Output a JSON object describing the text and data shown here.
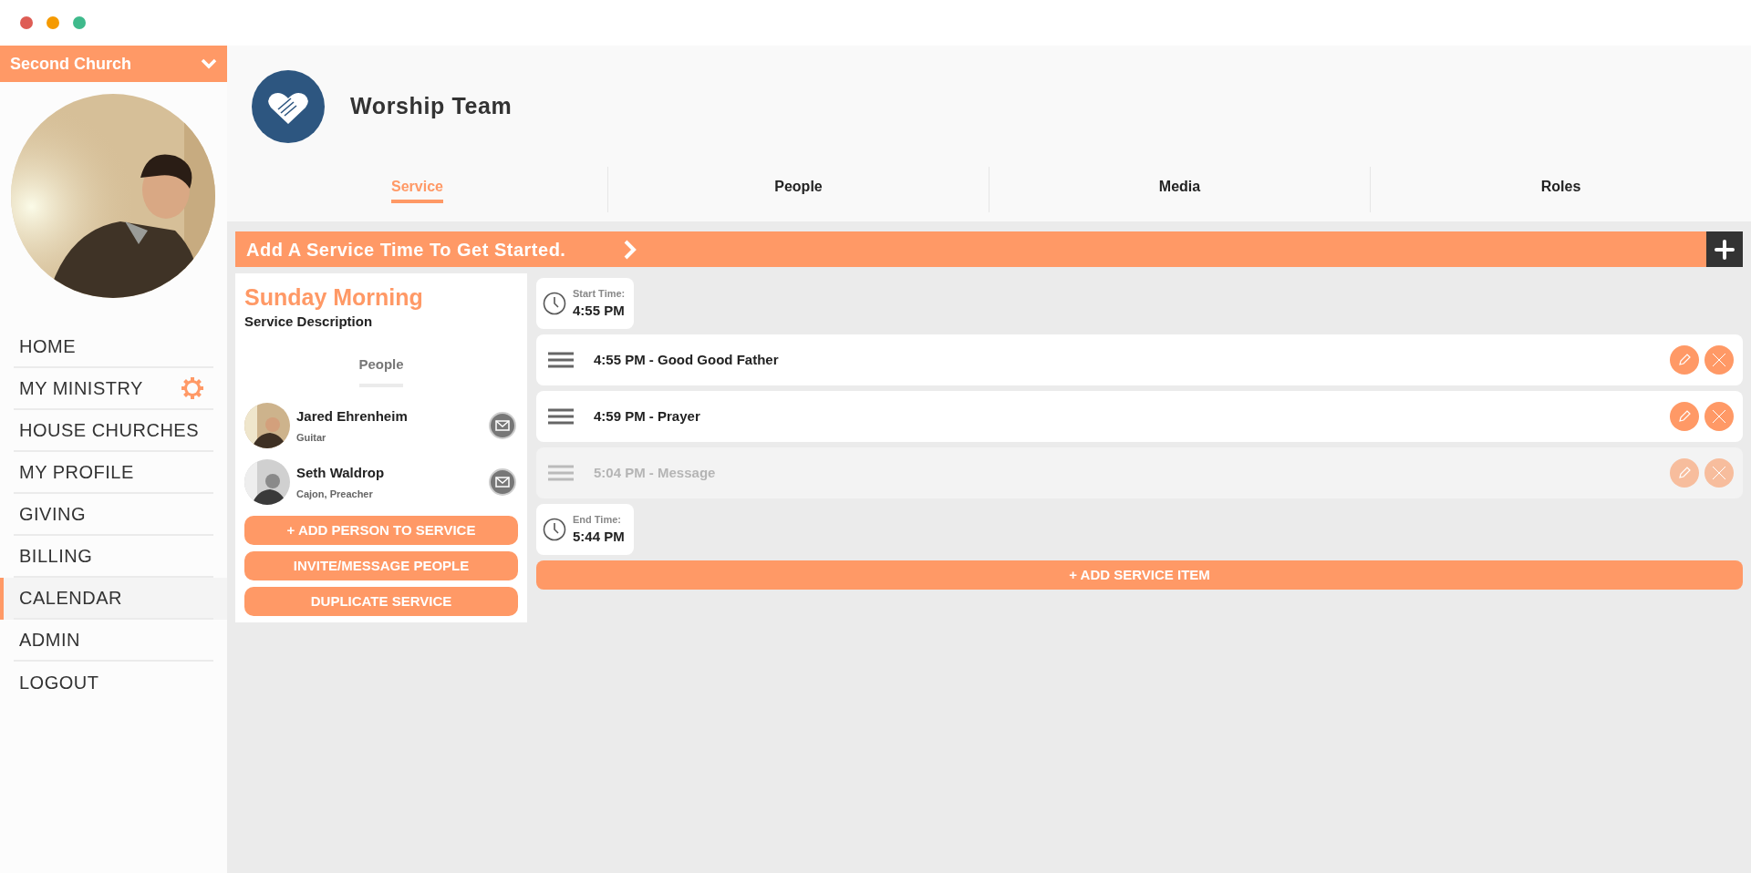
{
  "church_selector": {
    "label": "Second Church"
  },
  "sidebar": {
    "items": [
      {
        "label": "HOME",
        "selected": false,
        "has_gear": false
      },
      {
        "label": "MY MINISTRY",
        "selected": false,
        "has_gear": true
      },
      {
        "label": "HOUSE CHURCHES",
        "selected": false,
        "has_gear": false
      },
      {
        "label": "MY PROFILE",
        "selected": false,
        "has_gear": false
      },
      {
        "label": "GIVING",
        "selected": false,
        "has_gear": false
      },
      {
        "label": "BILLING",
        "selected": false,
        "has_gear": false
      },
      {
        "label": "CALENDAR",
        "selected": true,
        "has_gear": false
      },
      {
        "label": "ADMIN",
        "selected": false,
        "has_gear": false
      },
      {
        "label": "LOGOUT",
        "selected": false,
        "has_gear": false
      }
    ]
  },
  "team": {
    "title": "Worship Team"
  },
  "tabs": [
    {
      "label": "Service",
      "selected": true
    },
    {
      "label": "People",
      "selected": false
    },
    {
      "label": "Media",
      "selected": false
    },
    {
      "label": "Roles",
      "selected": false
    }
  ],
  "banner": {
    "text": "Add A Service Time To Get Started."
  },
  "service": {
    "title": "Sunday Morning",
    "description": "Service Description",
    "people_heading": "People",
    "people": [
      {
        "name": "Jared Ehrenheim",
        "role": "Guitar"
      },
      {
        "name": "Seth Waldrop",
        "role": "Cajon, Preacher"
      }
    ],
    "buttons": [
      "+ ADD PERSON TO SERVICE",
      "INVITE/MESSAGE PEOPLE",
      "DUPLICATE SERVICE"
    ]
  },
  "start": {
    "label": "Start Time:",
    "time": "4:55 PM"
  },
  "items": [
    {
      "text": "4:55 PM - Good Good Father",
      "disabled": false
    },
    {
      "text": "4:59 PM - Prayer",
      "disabled": false
    },
    {
      "text": "5:04 PM - Message",
      "disabled": true
    }
  ],
  "end": {
    "label": "End Time:",
    "time": "5:44 PM"
  },
  "add_item_button": "+ ADD SERVICE ITEM"
}
